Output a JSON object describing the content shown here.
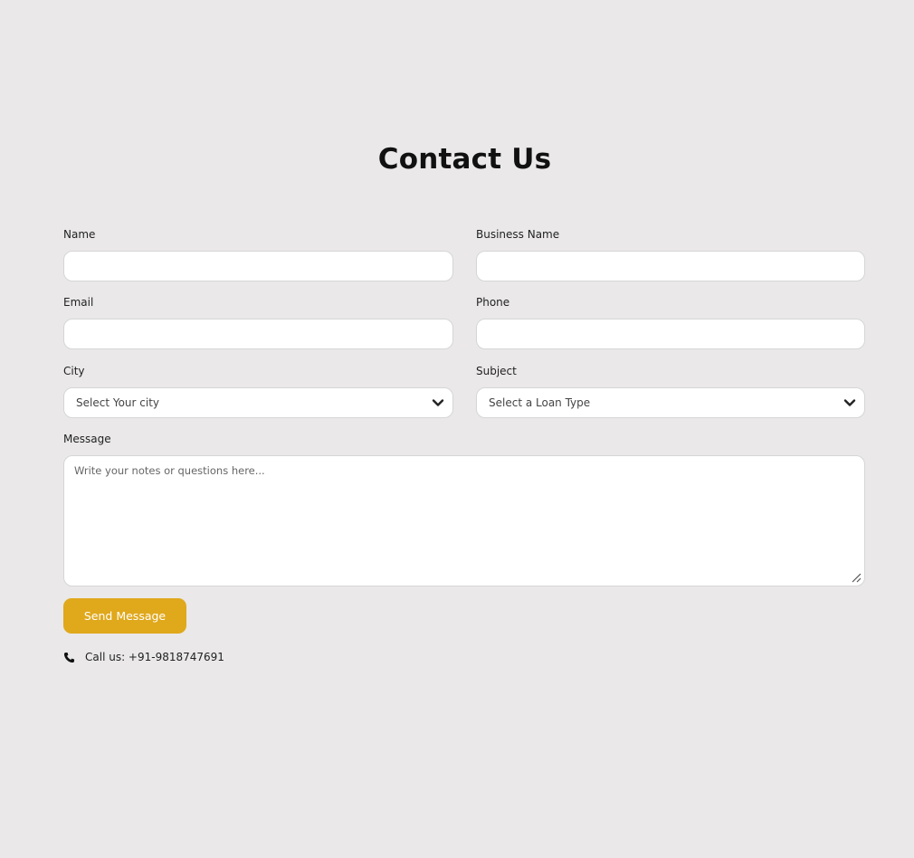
{
  "title": "Contact Us",
  "form": {
    "name_label": "Name",
    "business_label": "Business Name",
    "email_label": "Email",
    "phone_label": "Phone",
    "city_label": "City",
    "city_value": "Select Your city",
    "subject_label": "Subject",
    "subject_value": "Select a Loan Type",
    "message_label": "Message",
    "message_placeholder": "Write your notes or questions here...",
    "submit_label": "Send Message"
  },
  "contact": {
    "call_text": "Call us: +91-9818747691",
    "icon": "phone-icon"
  },
  "colors": {
    "background": "#eae8e8",
    "button": "#e0a81b"
  }
}
